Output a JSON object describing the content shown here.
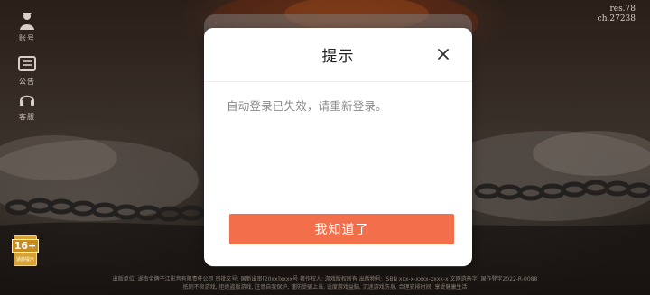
{
  "sidebar": {
    "account_label": "账号",
    "notice_label": "公告",
    "service_label": "客服"
  },
  "age_rating": {
    "number": "16+",
    "text": "适龄提示"
  },
  "version": {
    "res": "res.78",
    "ch": "ch.27238"
  },
  "footer": {
    "line1": "出版单位: 湖南金牌子江影音有限责任公司 审批文号: 国新出审[20xx]xxxx号 著作权人: 游戏版权所有 出版物号: ISBN xxx-x-xxxx-xxxx-x 文网游备字: 国作登字2022-R-0088",
    "line2": "抵制不良游戏, 拒绝盗版游戏, 注意自我保护, 谨防受骗上当, 适度游戏益脑, 沉迷游戏伤身, 合理安排时间, 享受健康生活"
  },
  "dialog": {
    "title": "提示",
    "message": "自动登录已失效，请重新登录。",
    "confirm_label": "我知道了"
  },
  "colors": {
    "confirm_button": "#f36f4c",
    "age_badge": "#d8a233",
    "dialog_background": "#ffffff"
  },
  "icons": {
    "close": "close-icon",
    "account": "account-icon",
    "notice": "notice-icon",
    "service": "headset-icon"
  }
}
